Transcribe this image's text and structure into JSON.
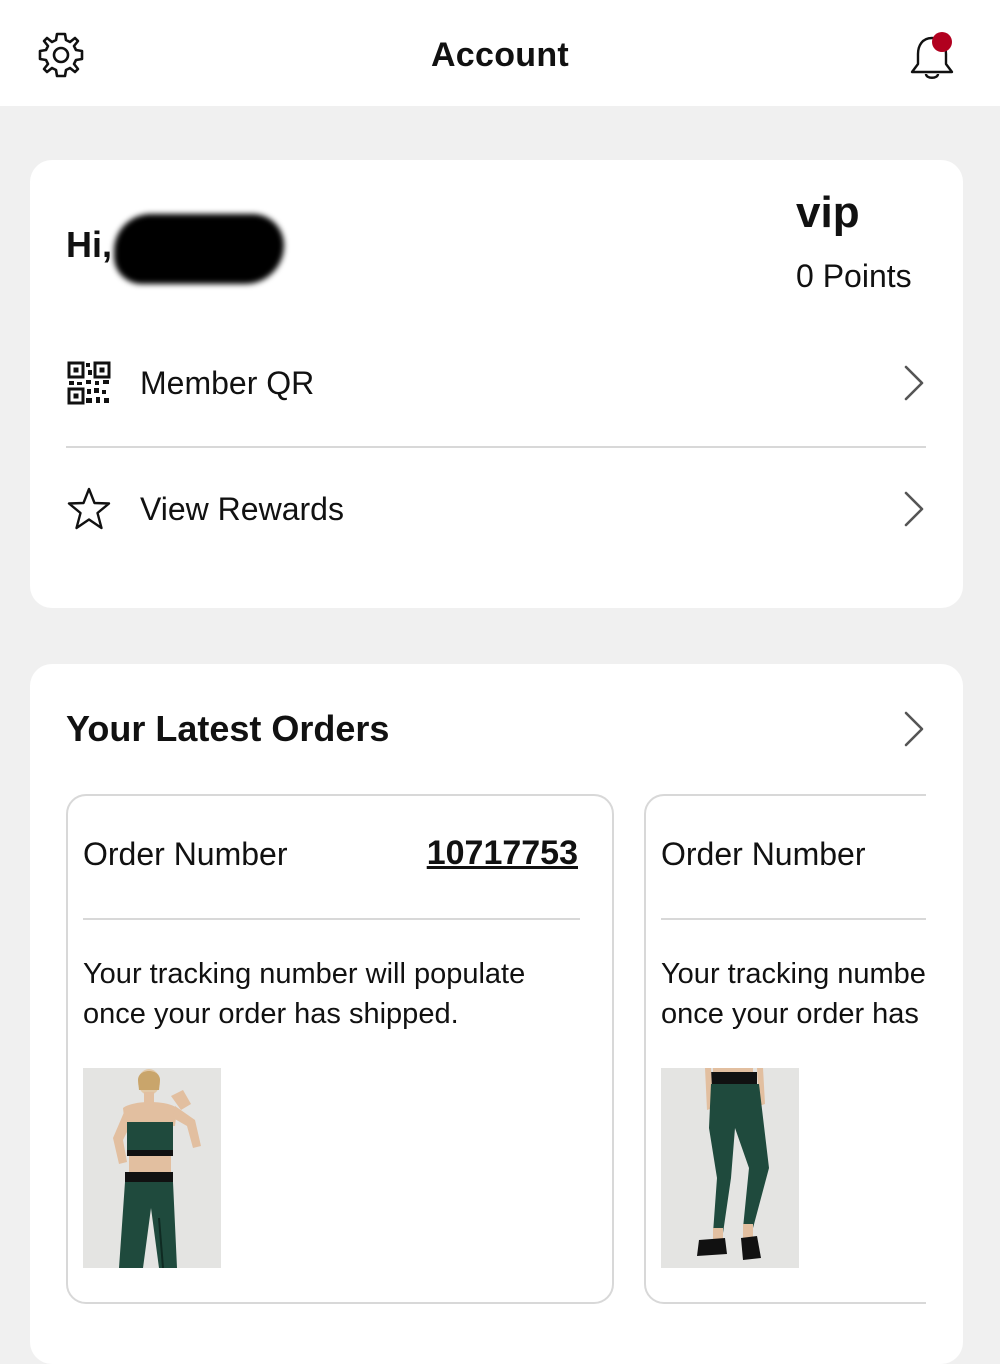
{
  "header": {
    "title": "Account",
    "settings_icon": "gear-icon",
    "notifications_icon": "bell-icon",
    "notification_dot_color": "#b1001f"
  },
  "account": {
    "greeting": "Hi,",
    "tier": "vip",
    "points": "0 Points",
    "menu": [
      {
        "label": "Member QR",
        "icon": "qr-code-icon"
      },
      {
        "label": "View Rewards",
        "icon": "star-icon"
      }
    ]
  },
  "orders": {
    "title": "Your Latest Orders",
    "items": [
      {
        "number_label": "Order Number",
        "number": "10717753",
        "tracking_line1": "Your tracking number will populate",
        "tracking_line2": "once your order has shipped.",
        "product": "green sports bra and leggings"
      },
      {
        "number_label": "Order Number",
        "tracking_line1": "Your tracking number will populate",
        "tracking_line2": "once your order has shipped.",
        "product": "green leggings"
      }
    ]
  }
}
